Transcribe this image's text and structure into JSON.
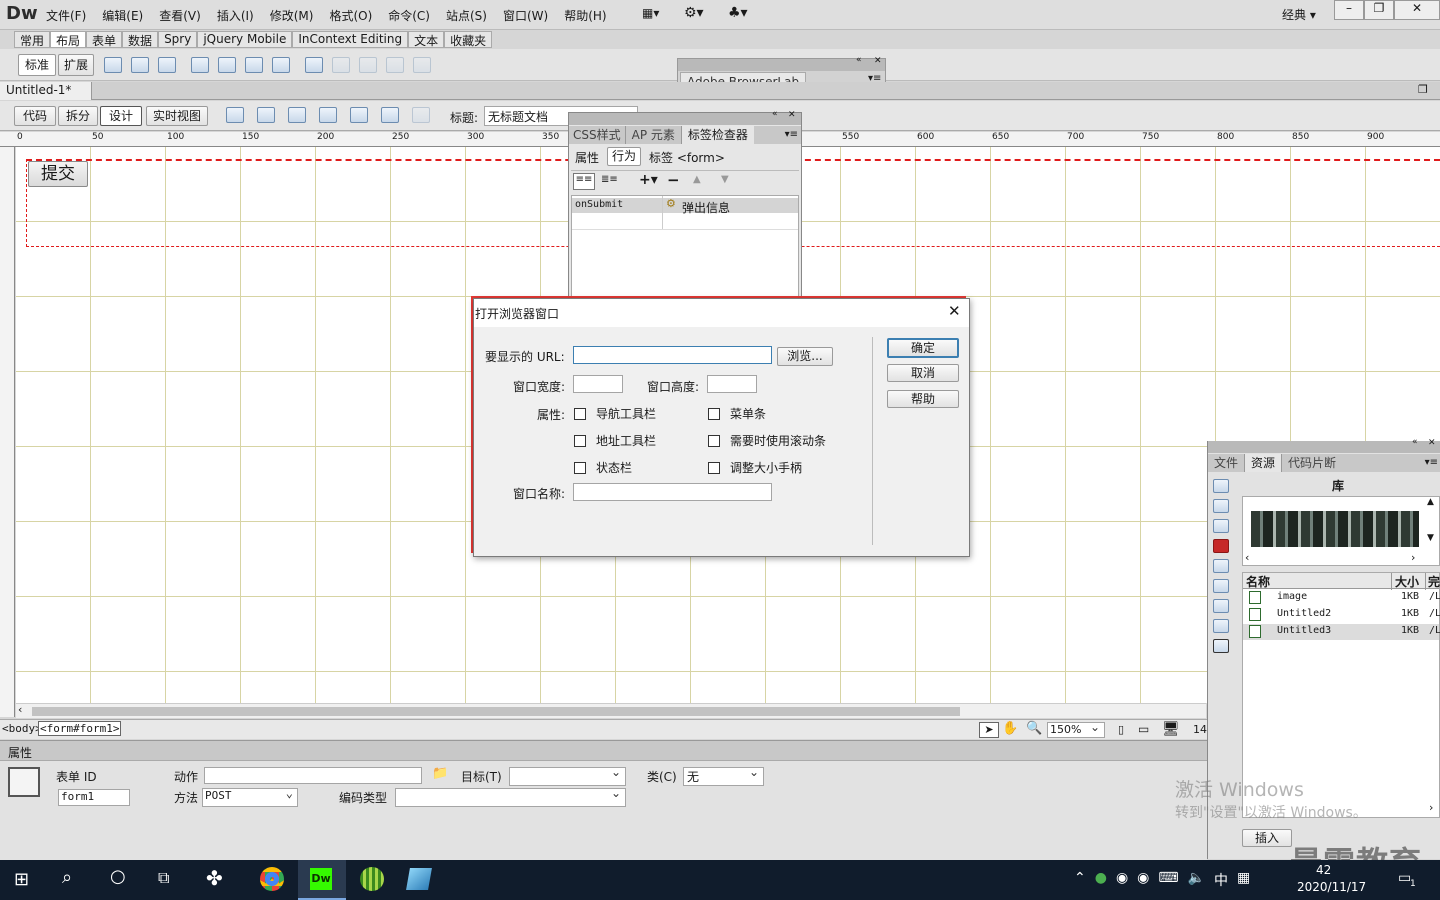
{
  "app": {
    "logo": "Dw"
  },
  "menu": [
    "文件(F)",
    "编辑(E)",
    "查看(V)",
    "插入(I)",
    "修改(M)",
    "格式(O)",
    "命令(C)",
    "站点(S)",
    "窗口(W)",
    "帮助(H)"
  ],
  "workspace": "经典",
  "insert_tabs": [
    "常用",
    "布局",
    "表单",
    "数据",
    "Spry",
    "jQuery Mobile",
    "InContext Editing",
    "文本",
    "收藏夹"
  ],
  "layout_buttons": [
    "标准",
    "扩展"
  ],
  "browserlab": {
    "title": "Adobe BrowserLab"
  },
  "doc_tab": {
    "name": "Untitled-1*"
  },
  "view_buttons": [
    "代码",
    "拆分",
    "设计",
    "实时视图"
  ],
  "title_label": "标题:",
  "title_value": "无标题文档",
  "ruler_numbers": [
    "0",
    "50",
    "100",
    "150",
    "200",
    "250",
    "300",
    "350",
    "550",
    "600",
    "650",
    "700",
    "750",
    "800",
    "850",
    "900"
  ],
  "design": {
    "submit_label": "提交"
  },
  "tag_panel": {
    "tabs": [
      "CSS样式",
      "AP 元素",
      "标签检查器"
    ],
    "subtabs": [
      "属性",
      "行为"
    ],
    "tag_label": "标签 <form>",
    "row": {
      "event": "onSubmit",
      "action": "弹出信息"
    }
  },
  "dialog": {
    "title": "打开浏览器窗口",
    "url_label": "要显示的 URL:",
    "url_value": "",
    "browse_label": "浏览...",
    "width_label": "窗口宽度:",
    "width_value": "",
    "height_label": "窗口高度:",
    "height_value": "",
    "attrs_label": "属性:",
    "checkboxes": [
      "导航工具栏",
      "菜单条",
      "地址工具栏",
      "需要时使用滚动条",
      "状态栏",
      "调整大小手柄"
    ],
    "name_label": "窗口名称:",
    "name_value": "",
    "ok": "确定",
    "cancel": "取消",
    "help": "帮助"
  },
  "status_bar": {
    "tags": [
      "<body>",
      "<form#form1>"
    ],
    "zoom": "150%",
    "size": "14"
  },
  "properties": {
    "header": "属性",
    "form_id_label": "表单 ID",
    "form_id_value": "form1",
    "action_label": "动作",
    "action_value": "",
    "target_label": "目标(T)",
    "target_value": "",
    "class_label": "类(C)",
    "class_value": "无",
    "method_label": "方法",
    "method_value": "POST",
    "enctype_label": "编码类型",
    "enctype_value": ""
  },
  "right_panel": {
    "tabs": [
      "文件",
      "资源",
      "代码片断"
    ],
    "library": "库",
    "columns": [
      "名称",
      "大小",
      "完"
    ],
    "files": [
      {
        "name": "image",
        "size": "1KB",
        "path": "/L"
      },
      {
        "name": "Untitled2",
        "size": "1KB",
        "path": "/L"
      },
      {
        "name": "Untitled3",
        "size": "1KB",
        "path": "/L"
      }
    ],
    "insert": "插入"
  },
  "watermark": {
    "line1": "激活 Windows",
    "line2": "转到\"设置\"以激活 Windows。",
    "brand": "最需教育"
  },
  "taskbar": {
    "lang": "中",
    "time": "42",
    "date": "2020/11/17",
    "notif": "1"
  }
}
